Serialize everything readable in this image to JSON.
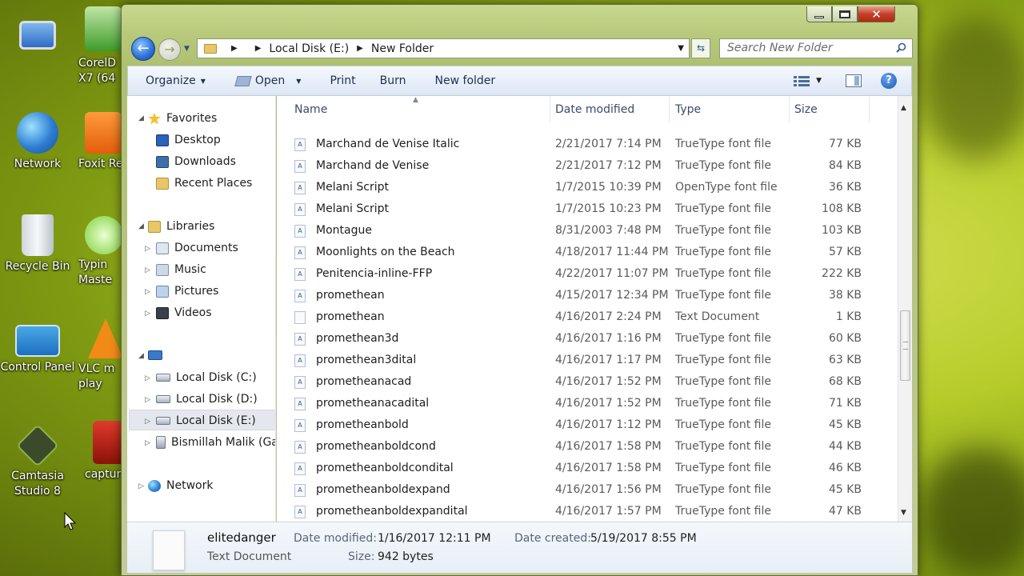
{
  "desktop": {
    "icons": [
      {
        "key": "computer",
        "label": ""
      },
      {
        "key": "network",
        "label": "Network"
      },
      {
        "key": "recycle",
        "label": "Recycle Bin"
      },
      {
        "key": "control",
        "label": "Control Panel"
      },
      {
        "key": "camtasia",
        "label": "Camtasia\nStudio 8"
      },
      {
        "key": "coreldraw",
        "label": "CorelD\nX7 (64"
      },
      {
        "key": "foxit",
        "label": "Foxit Re"
      },
      {
        "key": "typing",
        "label": "Typin\nMaste"
      },
      {
        "key": "vlc",
        "label": "VLC m\nplay"
      },
      {
        "key": "capture",
        "label": "captur"
      }
    ]
  },
  "window": {
    "address": {
      "segments": [
        "Local Disk (E:)",
        "New Folder"
      ]
    },
    "search_placeholder": "Search New Folder",
    "toolbar": {
      "organize": "Organize",
      "open": "Open",
      "print": "Print",
      "burn": "Burn",
      "new_folder": "New folder"
    }
  },
  "nav": {
    "favorites": "Favorites",
    "desktop": "Desktop",
    "downloads": "Downloads",
    "recent": "Recent Places",
    "libraries": "Libraries",
    "documents": "Documents",
    "music": "Music",
    "pictures": "Pictures",
    "videos": "Videos",
    "disk_c": "Local Disk (C:)",
    "disk_d": "Local Disk (D:)",
    "disk_e": "Local Disk (E:)",
    "bismillah": "Bismillah Malik (Ga",
    "network": "Network"
  },
  "columns": {
    "name": "Name",
    "date": "Date modified",
    "type": "Type",
    "size": "Size"
  },
  "files": [
    {
      "name": "Marchand de Venise Italic",
      "date": "2/21/2017 7:14 PM",
      "type": "TrueType font file",
      "size": "77 KB",
      "kind": "font"
    },
    {
      "name": "Marchand de Venise",
      "date": "2/21/2017 7:12 PM",
      "type": "TrueType font file",
      "size": "84 KB",
      "kind": "font"
    },
    {
      "name": "Melani Script",
      "date": "1/7/2015 10:39 PM",
      "type": "OpenType font file",
      "size": "36 KB",
      "kind": "font"
    },
    {
      "name": "Melani Script",
      "date": "1/7/2015 10:23 PM",
      "type": "TrueType font file",
      "size": "108 KB",
      "kind": "font"
    },
    {
      "name": "Montague",
      "date": "8/31/2003 7:48 PM",
      "type": "TrueType font file",
      "size": "103 KB",
      "kind": "font"
    },
    {
      "name": "Moonlights on the Beach",
      "date": "4/18/2017 11:44 PM",
      "type": "TrueType font file",
      "size": "57 KB",
      "kind": "font"
    },
    {
      "name": "Penitencia-inline-FFP",
      "date": "4/22/2017 11:07 PM",
      "type": "TrueType font file",
      "size": "222 KB",
      "kind": "font"
    },
    {
      "name": "promethean",
      "date": "4/15/2017 12:34 PM",
      "type": "TrueType font file",
      "size": "38 KB",
      "kind": "font"
    },
    {
      "name": "promethean",
      "date": "4/16/2017 2:24 PM",
      "type": "Text Document",
      "size": "1 KB",
      "kind": "text"
    },
    {
      "name": "promethean3d",
      "date": "4/16/2017 1:16 PM",
      "type": "TrueType font file",
      "size": "60 KB",
      "kind": "font"
    },
    {
      "name": "promethean3dital",
      "date": "4/16/2017 1:17 PM",
      "type": "TrueType font file",
      "size": "63 KB",
      "kind": "font"
    },
    {
      "name": "prometheanacad",
      "date": "4/16/2017 1:52 PM",
      "type": "TrueType font file",
      "size": "68 KB",
      "kind": "font"
    },
    {
      "name": "prometheanacadital",
      "date": "4/16/2017 1:52 PM",
      "type": "TrueType font file",
      "size": "71 KB",
      "kind": "font"
    },
    {
      "name": "prometheanbold",
      "date": "4/16/2017 1:12 PM",
      "type": "TrueType font file",
      "size": "45 KB",
      "kind": "font"
    },
    {
      "name": "prometheanboldcond",
      "date": "4/16/2017 1:58 PM",
      "type": "TrueType font file",
      "size": "44 KB",
      "kind": "font"
    },
    {
      "name": "prometheanboldcondital",
      "date": "4/16/2017 1:58 PM",
      "type": "TrueType font file",
      "size": "46 KB",
      "kind": "font"
    },
    {
      "name": "prometheanboldexpand",
      "date": "4/16/2017 1:56 PM",
      "type": "TrueType font file",
      "size": "45 KB",
      "kind": "font"
    },
    {
      "name": "prometheanboldexpandital",
      "date": "4/16/2017 1:57 PM",
      "type": "TrueType font file",
      "size": "47 KB",
      "kind": "font"
    }
  ],
  "details": {
    "name": "elitedanger",
    "type": "Text Document",
    "modified_label": "Date modified:",
    "modified": "1/16/2017 12:11 PM",
    "created_label": "Date created:",
    "created": "5/19/2017 8:55 PM",
    "size_label": "Size:",
    "size": "942 bytes"
  }
}
